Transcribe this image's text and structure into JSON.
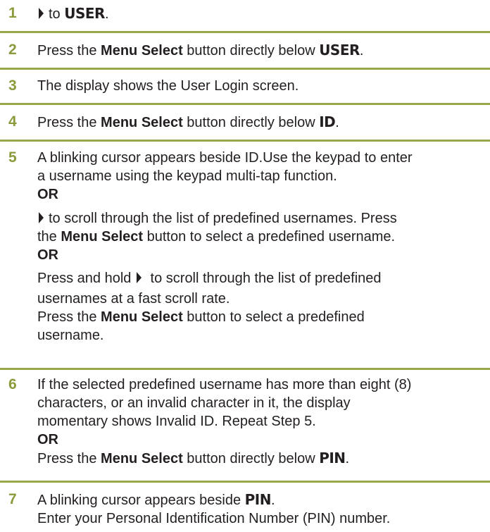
{
  "steps": [
    {
      "num": "1",
      "text_after_arrow": "to ",
      "display": "USER",
      "end": "."
    },
    {
      "num": "2",
      "pre": "Press the ",
      "bold": "Menu Select",
      "post": " button directly below ",
      "display": "USER",
      "end": "."
    },
    {
      "num": "3",
      "text": "The display shows the User Login screen."
    },
    {
      "num": "4",
      "pre": "Press the ",
      "bold": "Menu Select",
      "post": " button directly below ",
      "display": "ID",
      "end": "."
    },
    {
      "num": "5",
      "line1": "A blinking cursor appears beside ID.Use the keypad to enter",
      "line2": "a username using the keypad multi-tap function.",
      "or": "OR",
      "line3": "to scroll through the list of predefined usernames. Press",
      "line4_pre": "the ",
      "line4_bold": "Menu Select",
      "line4_post": " button to select a predefined username.",
      "line5_pre": "Press and hold ",
      "line5_post": " to scroll through the list of predefined",
      "line6": "usernames at a fast scroll rate.",
      "line7_pre": "Press the ",
      "line7_bold": "Menu Select",
      "line7_post": " button to select a predefined",
      "line8": "username."
    },
    {
      "num": "6",
      "line1": "If the selected predefined username has more than eight (8)",
      "line2": "characters, or an invalid character in it, the display",
      "line3": "momentary shows Invalid ID. Repeat Step 5.",
      "or": "OR",
      "line4_pre": "Press the ",
      "line4_bold": "Menu Select",
      "line4_post": " button directly below ",
      "display": "PIN",
      "end": "."
    },
    {
      "num": "7",
      "line1_pre": "A blinking cursor appears beside ",
      "display": "PIN",
      "end": ".",
      "line2": "Enter your Personal Identification Number (PIN) number."
    }
  ]
}
